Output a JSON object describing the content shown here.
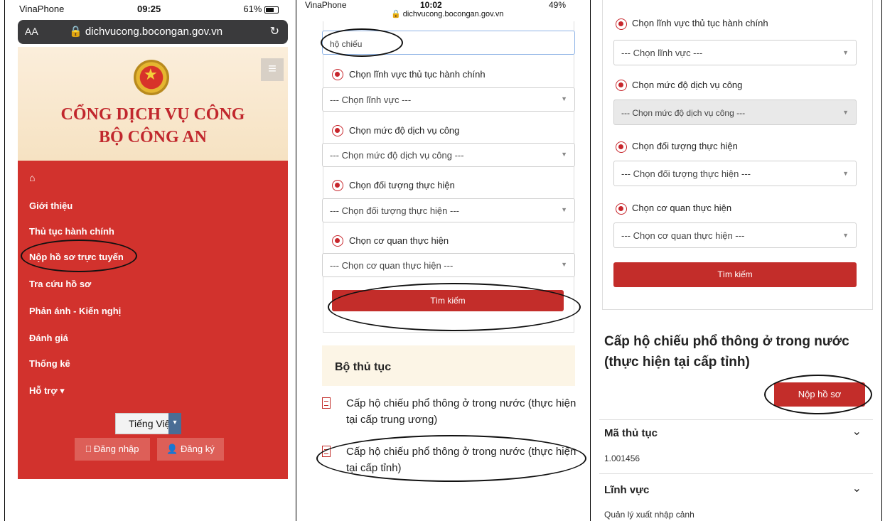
{
  "panel1": {
    "status": {
      "carrier": "VinaPhone",
      "time": "09:25",
      "battery": "61%"
    },
    "browser": {
      "text_size": "AA",
      "url": "dichvucong.bocongan.gov.vn"
    },
    "portal": {
      "line1": "CỔNG DỊCH VỤ CÔNG",
      "line2": "BỘ CÔNG AN"
    },
    "nav": [
      "Giới thiệu",
      "Thủ tục hành chính",
      "Nộp hồ sơ trực tuyến",
      "Tra cứu hồ sơ",
      "Phản ánh - Kiến nghị",
      "Đánh giá",
      "Thống kê",
      "Hỗ trợ"
    ],
    "language": "Tiếng Việt",
    "login": "Đăng nhập",
    "register": "Đăng ký"
  },
  "panel2": {
    "status": {
      "carrier": "VinaPhone",
      "time": "10:02",
      "battery": "49%",
      "url": "dichvucong.bocongan.gov.vn"
    },
    "search_value": "hộ chiếu",
    "filters": [
      {
        "label": "Chọn lĩnh vực thủ tục hành chính",
        "placeholder": "--- Chọn lĩnh vực ---"
      },
      {
        "label": "Chọn mức độ dịch vụ công",
        "placeholder": "--- Chọn mức độ dịch vụ công ---"
      },
      {
        "label": "Chọn đối tượng thực hiện",
        "placeholder": "--- Chọn đối tượng thực hiện ---"
      },
      {
        "label": "Chọn cơ quan thực hiện",
        "placeholder": "--- Chọn cơ quan thực hiện ---"
      }
    ],
    "search_button": "Tìm kiếm",
    "section_title": "Bộ thủ tục",
    "procedures": [
      "Cấp hộ chiếu phổ thông ở trong nước (thực hiện tại cấp trung ương)",
      "Cấp hộ chiếu phổ thông ở trong nước (thực hiện tại cấp tỉnh)"
    ]
  },
  "panel3": {
    "filters": [
      {
        "label": "Chọn lĩnh vực thủ tục hành chính",
        "placeholder": "--- Chọn lĩnh vực ---"
      },
      {
        "label": "Chọn mức độ dịch vụ công",
        "placeholder": "--- Chọn mức độ dịch vụ công ---"
      },
      {
        "label": "Chọn đối tượng thực hiện",
        "placeholder": "--- Chọn đối tượng thực hiện ---"
      },
      {
        "label": "Chọn cơ quan thực hiện",
        "placeholder": "--- Chọn cơ quan thực hiện ---"
      }
    ],
    "search_button": "Tìm kiếm",
    "procedure_title": "Cấp hộ chiếu phổ thông ở trong nước (thực hiện tại cấp tỉnh)",
    "submit_button": "Nộp hồ sơ",
    "sections": [
      {
        "label": "Mã thủ tục",
        "value": "1.001456"
      },
      {
        "label": "Lĩnh vực",
        "value": "Quản lý xuất nhập cảnh"
      }
    ]
  }
}
